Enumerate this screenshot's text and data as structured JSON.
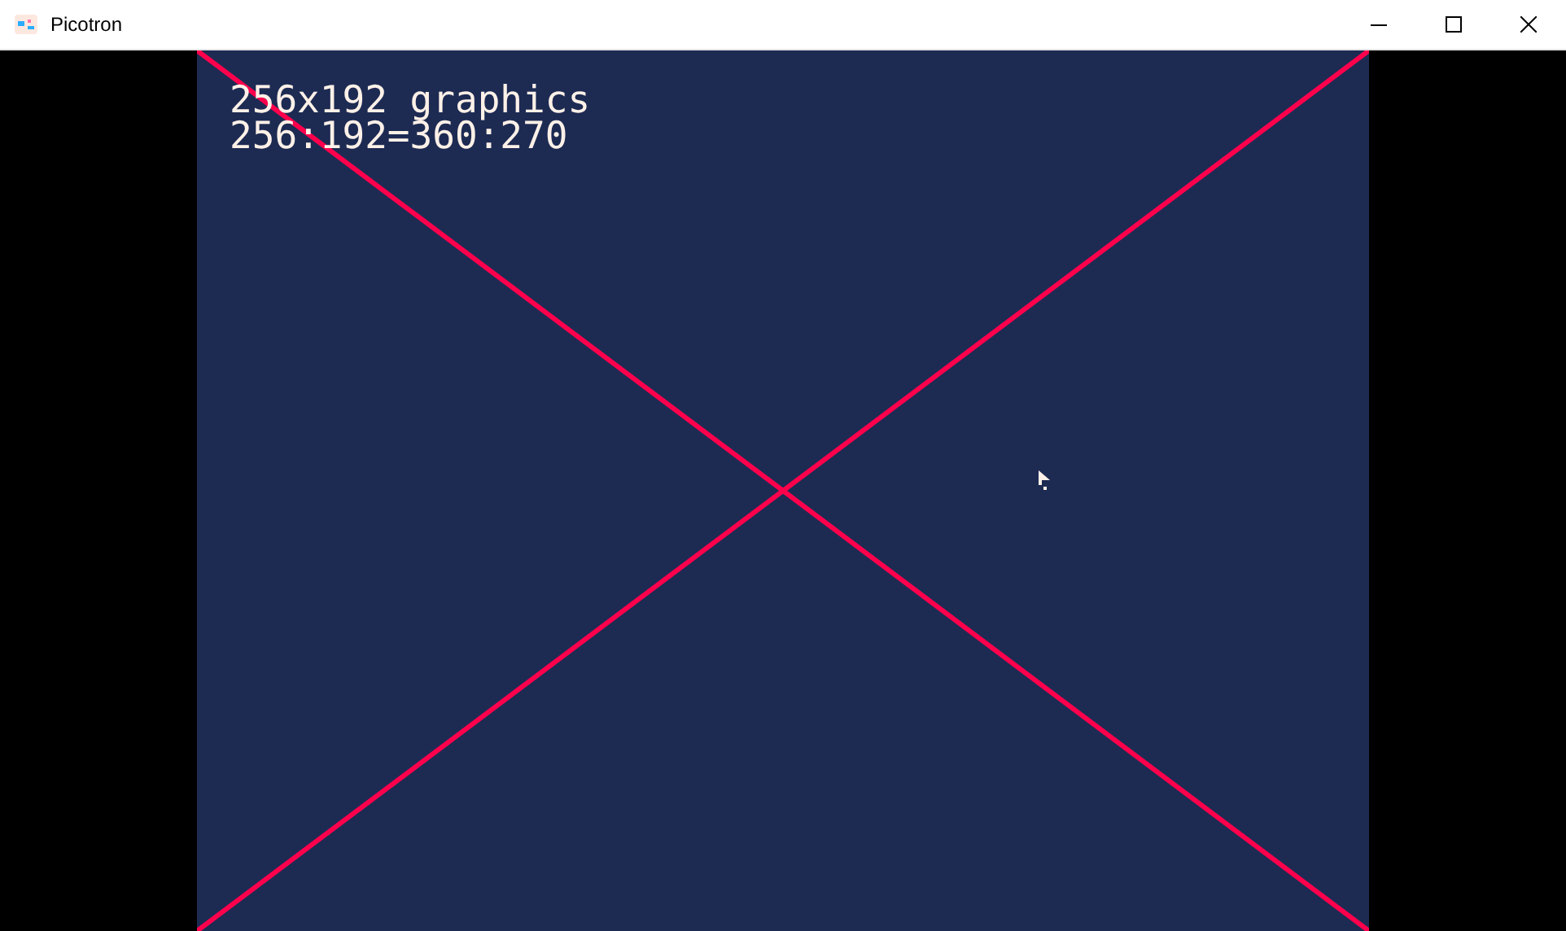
{
  "window": {
    "title": "Picotron"
  },
  "screen": {
    "lines": [
      "256x192 graphics",
      "256:192=360:270"
    ]
  }
}
